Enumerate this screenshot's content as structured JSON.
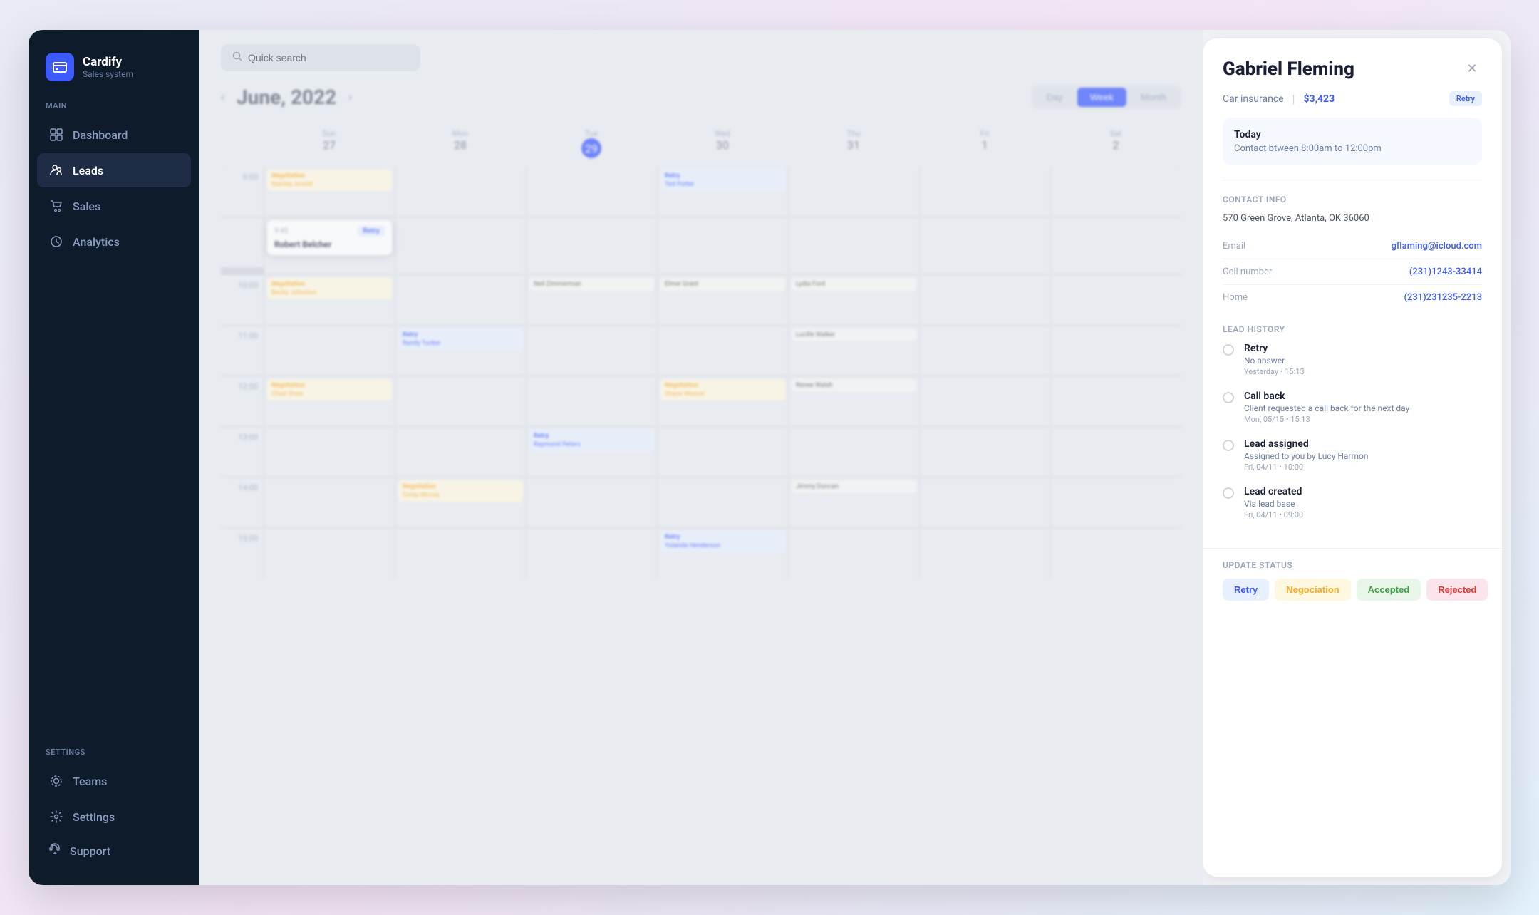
{
  "app": {
    "name": "Cardify",
    "subtitle": "Sales system"
  },
  "search": {
    "placeholder": "Quick search"
  },
  "nav": {
    "main_label": "Main",
    "items": [
      {
        "id": "dashboard",
        "label": "Dashboard",
        "icon": "⊞"
      },
      {
        "id": "leads",
        "label": "Leads",
        "icon": "👥",
        "active": true
      },
      {
        "id": "sales",
        "label": "Sales",
        "icon": "🛒"
      },
      {
        "id": "analytics",
        "label": "Analytics",
        "icon": "🕐"
      }
    ],
    "settings_label": "Settings",
    "settings_items": [
      {
        "id": "teams",
        "label": "Teams",
        "icon": "⚙"
      },
      {
        "id": "settings",
        "label": "Settings",
        "icon": "⚙"
      }
    ],
    "support_label": "Support"
  },
  "calendar": {
    "title": "June, 2022",
    "view_day": "Day",
    "view_week": "Week",
    "view_month": "Month",
    "active_view": "Week",
    "days": [
      {
        "label": "Sun",
        "num": "27"
      },
      {
        "label": "Mon",
        "num": "28"
      },
      {
        "label": "Tue",
        "num": "29",
        "today": true
      },
      {
        "label": "Wed",
        "num": "30"
      },
      {
        "label": "Thu",
        "num": "31"
      },
      {
        "label": "Fri",
        "num": "1"
      }
    ],
    "times": [
      "9:00",
      "10:00",
      "11:00",
      "12:00",
      "13:00",
      "14:00",
      "15:00"
    ],
    "events": [
      {
        "name": "Stanley Arnold",
        "badge": "Negotiation",
        "day": 0,
        "row": 0
      },
      {
        "name": "Robert Belcher",
        "badge": "Retry",
        "day": 0,
        "row": 0,
        "active": true,
        "time": "9:45"
      },
      {
        "name": "Becky Johnston",
        "badge": "Negotiation",
        "day": 0,
        "row": 2
      },
      {
        "name": "Chad Shaw",
        "badge": "Negotiation",
        "day": 0,
        "row": 4
      },
      {
        "name": "Ted Potter",
        "badge": "Retry",
        "day": 3,
        "row": 0
      },
      {
        "name": "Neil Zimmerman",
        "badge": "",
        "day": 2,
        "row": 2
      },
      {
        "name": "Elmer Grant",
        "badge": "",
        "day": 3,
        "row": 2
      },
      {
        "name": "Lydia Ford",
        "badge": "",
        "day": 4,
        "row": 2
      },
      {
        "name": "Randy Tucker",
        "badge": "Retry",
        "day": 1,
        "row": 3
      },
      {
        "name": "Lucille Walker",
        "badge": "",
        "day": 4,
        "row": 3
      },
      {
        "name": "Shane Weaver",
        "badge": "Negotiation",
        "day": 3,
        "row": 4
      },
      {
        "name": "Renee Walsh",
        "badge": "",
        "day": 4,
        "row": 4
      },
      {
        "name": "Raymond Peters",
        "badge": "Retry",
        "day": 2,
        "row": 5
      },
      {
        "name": "Corey Mccoy",
        "badge": "Negotiation",
        "day": 1,
        "row": 6
      },
      {
        "name": "Jimmy Duncan",
        "badge": "",
        "day": 4,
        "row": 6
      },
      {
        "name": "Yolanda Henderson",
        "badge": "Retry",
        "day": 3,
        "row": 7
      }
    ]
  },
  "panel": {
    "name": "Gabriel Fleming",
    "product": "Car insurance",
    "price": "$3,423",
    "retry_badge": "Retry",
    "schedule_today": "Today",
    "schedule_time": "Contact btween 8:00am to 12:00pm",
    "contact_section_title": "Contact info",
    "address": "570 Green Grove, Atlanta, OK 36060",
    "email_label": "Email",
    "email_value": "gflaming@icloud.com",
    "cell_label": "Cell number",
    "cell_value": "(231)1243-33414",
    "home_label": "Home",
    "home_value": "(231)231235-2213",
    "history_title": "Lead History",
    "history_items": [
      {
        "title": "Retry",
        "desc": "No answer",
        "time": "Yesterday • 15:13"
      },
      {
        "title": "Call back",
        "desc": "Client requested a call back for the next day",
        "time": "Mon, 05/15 • 15:13"
      },
      {
        "title": "Lead assigned",
        "desc": "Assigned to you by Lucy Harmon",
        "time": "Fri, 04/11 • 10:00"
      },
      {
        "title": "Lead created",
        "desc": "Via lead base",
        "time": "Fri, 04/11 • 09:00"
      }
    ],
    "update_status_title": "Update status",
    "status_buttons": [
      {
        "id": "retry",
        "label": "Retry",
        "class": "retry"
      },
      {
        "id": "negotiation",
        "label": "Negociation",
        "class": "negotiation"
      },
      {
        "id": "accepted",
        "label": "Accepted",
        "class": "accepted"
      },
      {
        "id": "rejected",
        "label": "Rejected",
        "class": "rejected"
      }
    ]
  }
}
